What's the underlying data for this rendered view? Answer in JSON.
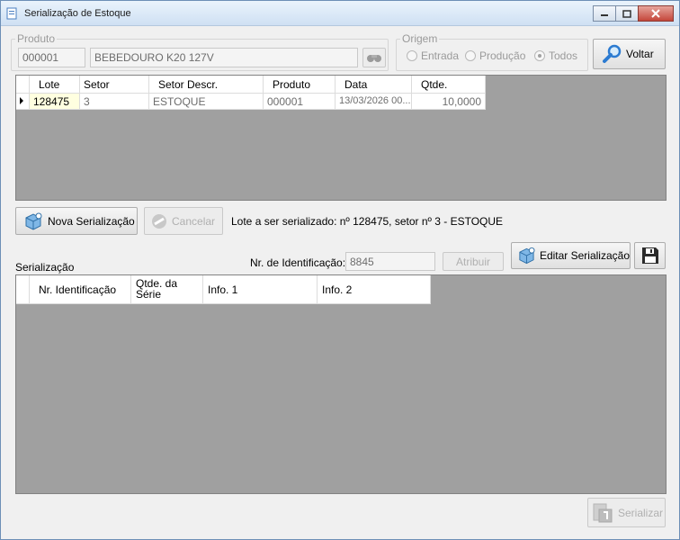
{
  "window": {
    "title": "Serialização de Estoque"
  },
  "produto": {
    "legend": "Produto",
    "code": "000001",
    "description": "BEBEDOURO K20 127V"
  },
  "origem": {
    "legend": "Origem",
    "options": [
      "Entrada",
      "Produção",
      "Todos"
    ],
    "selected": "Todos"
  },
  "buttons": {
    "voltar": "Voltar",
    "nova_serializacao": "Nova Serialização",
    "cancelar": "Cancelar",
    "atribuir": "Atribuir",
    "editar_serializacao": "Editar Serialização",
    "serializar": "Serializar"
  },
  "lotes_grid": {
    "columns": [
      "Lote",
      "Setor",
      "Setor Descr.",
      "Produto",
      "Data",
      "Qtde."
    ],
    "rows": [
      [
        "128475",
        "3",
        "ESTOQUE",
        "000001",
        "13/03/2026 00...",
        "10,0000"
      ]
    ]
  },
  "lote_info": "Lote a ser serializado: nº 128475, setor nº 3 - ESTOQUE",
  "serializacao": {
    "label": "Serialização",
    "nr_label": "Nr. de Identificação:",
    "nr_value": "8845",
    "columns": [
      "Nr. Identificação",
      "Qtde. da Série",
      "Info. 1",
      "Info. 2"
    ]
  }
}
